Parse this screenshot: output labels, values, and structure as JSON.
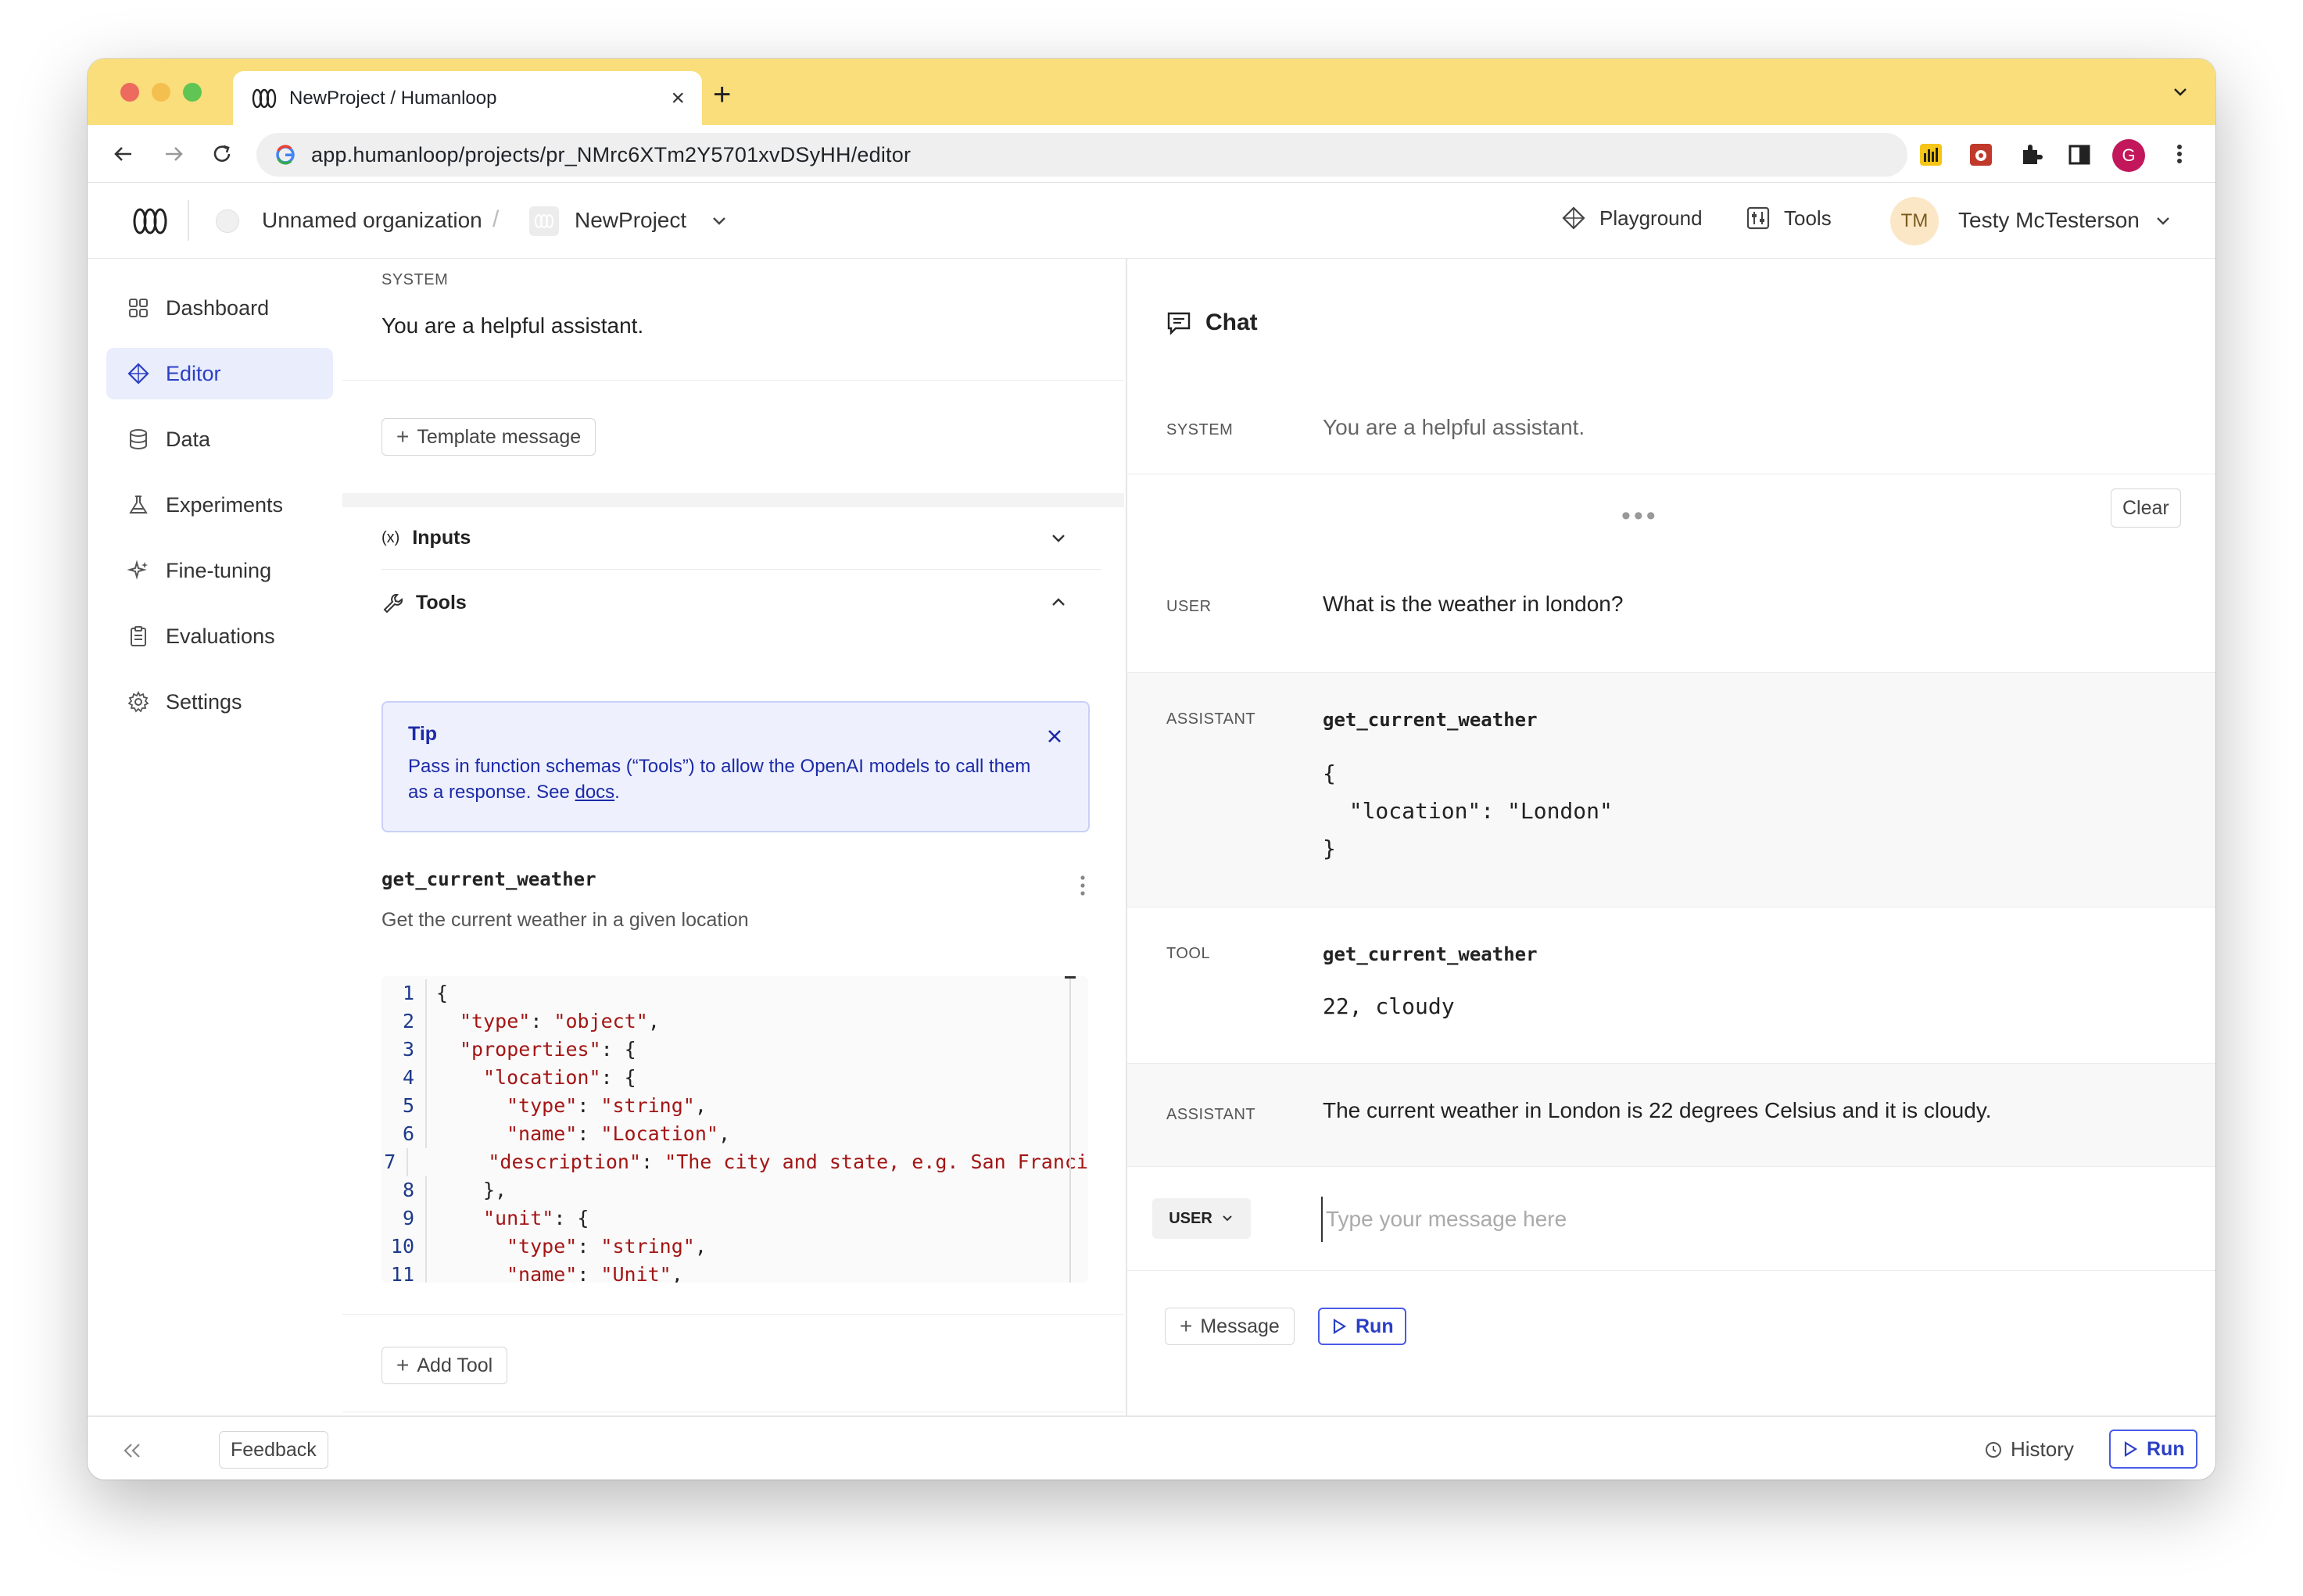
{
  "browser": {
    "tab_title": "NewProject / Humanloop",
    "url": "app.humanloop/projects/pr_NMrc6XTm2Y5701xvDSyHH/editor",
    "profile_initial": "G"
  },
  "header": {
    "org_name": "Unnamed organization",
    "breadcrumb_separator": "/",
    "project_name": "NewProject",
    "links": [
      "Playground",
      "Tools"
    ],
    "avatar_initials": "TM",
    "user_name": "Testy McTesterson"
  },
  "sidebar": {
    "items": [
      {
        "label": "Dashboard",
        "icon": "grid-icon"
      },
      {
        "label": "Editor",
        "icon": "diamond-icon"
      },
      {
        "label": "Data",
        "icon": "database-icon"
      },
      {
        "label": "Experiments",
        "icon": "flask-icon"
      },
      {
        "label": "Fine-tuning",
        "icon": "sparkles-icon"
      },
      {
        "label": "Evaluations",
        "icon": "clipboard-icon"
      },
      {
        "label": "Settings",
        "icon": "gear-icon"
      }
    ],
    "active_index": 1
  },
  "editor": {
    "system_label": "SYSTEM",
    "system_text": "You are a helpful assistant.",
    "template_button": "Template message",
    "inputs_label": "Inputs",
    "tools_label": "Tools",
    "tip": {
      "title": "Tip",
      "body": "Pass in function schemas (“Tools”) to allow the OpenAI models to call them as a response. See ",
      "link": "docs",
      "suffix": "."
    },
    "function_name": "get_current_weather",
    "function_description": "Get the current weather in a given location",
    "code_lines": [
      {
        "n": "1",
        "indent": 0,
        "parts": [
          [
            "p",
            "{"
          ]
        ]
      },
      {
        "n": "2",
        "indent": 1,
        "parts": [
          [
            "s",
            "\"type\""
          ],
          [
            "p",
            ": "
          ],
          [
            "s",
            "\"object\""
          ],
          [
            "p",
            ","
          ]
        ]
      },
      {
        "n": "3",
        "indent": 1,
        "parts": [
          [
            "s",
            "\"properties\""
          ],
          [
            "p",
            ": {"
          ]
        ]
      },
      {
        "n": "4",
        "indent": 2,
        "parts": [
          [
            "s",
            "\"location\""
          ],
          [
            "p",
            ": {"
          ]
        ]
      },
      {
        "n": "5",
        "indent": 3,
        "parts": [
          [
            "s",
            "\"type\""
          ],
          [
            "p",
            ": "
          ],
          [
            "s",
            "\"string\""
          ],
          [
            "p",
            ","
          ]
        ]
      },
      {
        "n": "6",
        "indent": 3,
        "parts": [
          [
            "s",
            "\"name\""
          ],
          [
            "p",
            ": "
          ],
          [
            "s",
            "\"Location\""
          ],
          [
            "p",
            ","
          ]
        ]
      },
      {
        "n": "7",
        "indent": 3,
        "parts": [
          [
            "s",
            "\"description\""
          ],
          [
            "p",
            ": "
          ],
          [
            "s",
            "\"The city and state, e.g. San Franci"
          ]
        ]
      },
      {
        "n": "8",
        "indent": 2,
        "parts": [
          [
            "p",
            "},"
          ]
        ]
      },
      {
        "n": "9",
        "indent": 2,
        "parts": [
          [
            "s",
            "\"unit\""
          ],
          [
            "p",
            ": {"
          ]
        ]
      },
      {
        "n": "10",
        "indent": 3,
        "parts": [
          [
            "s",
            "\"type\""
          ],
          [
            "p",
            ": "
          ],
          [
            "s",
            "\"string\""
          ],
          [
            "p",
            ","
          ]
        ]
      },
      {
        "n": "11",
        "indent": 3,
        "parts": [
          [
            "s",
            "\"name\""
          ],
          [
            "p",
            ": "
          ],
          [
            "s",
            "\"Unit\""
          ],
          [
            "p",
            ","
          ]
        ]
      }
    ],
    "add_tool_button": "Add Tool"
  },
  "chat": {
    "title": "Chat",
    "clear_button": "Clear",
    "messages": [
      {
        "role": "SYSTEM",
        "text": "You are a helpful assistant."
      },
      {
        "role": "USER",
        "text": "What is the weather in london?"
      },
      {
        "role": "ASSISTANT",
        "function": "get_current_weather",
        "args": [
          "{",
          "  \"location\": \"London\"",
          "}"
        ]
      },
      {
        "role": "TOOL",
        "function": "get_current_weather",
        "result": "22, cloudy"
      },
      {
        "role": "ASSISTANT",
        "text": "The current weather in London is 22 degrees Celsius and it is cloudy."
      }
    ],
    "input_role": "USER",
    "input_placeholder": "Type your message here",
    "message_button": "Message",
    "run_button": "Run"
  },
  "footer": {
    "feedback_button": "Feedback",
    "history_label": "History",
    "run_button": "Run"
  },
  "colors": {
    "tabbar": "#f9de7b",
    "accent": "#2b3fc4",
    "active_bg": "#e9edfc"
  }
}
